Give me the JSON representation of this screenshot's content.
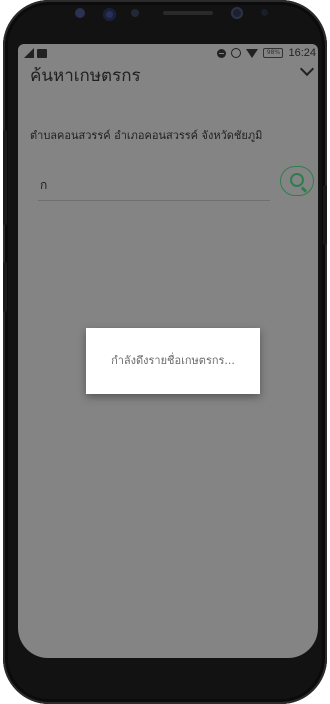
{
  "status_bar": {
    "time": "16:24",
    "battery_level": "98%",
    "icons": [
      "signal-icon",
      "image-icon",
      "dnd-icon",
      "alarm-icon",
      "wifi-icon",
      "battery-icon"
    ]
  },
  "app": {
    "title": "ค้นหาเกษตรกร",
    "location_label": "ตำบลคอนสวรรค์ อำเภอคอนสวรรค์ จังหวัดชัยภูมิ"
  },
  "search": {
    "value": "ก",
    "accent_color": "#2f7d4e"
  },
  "dialog": {
    "loading_text": "กำลังดึงรายชื่อเกษตรกร..."
  },
  "colors": {
    "overlay_bg": "#848484",
    "phone_body": "#121212"
  }
}
